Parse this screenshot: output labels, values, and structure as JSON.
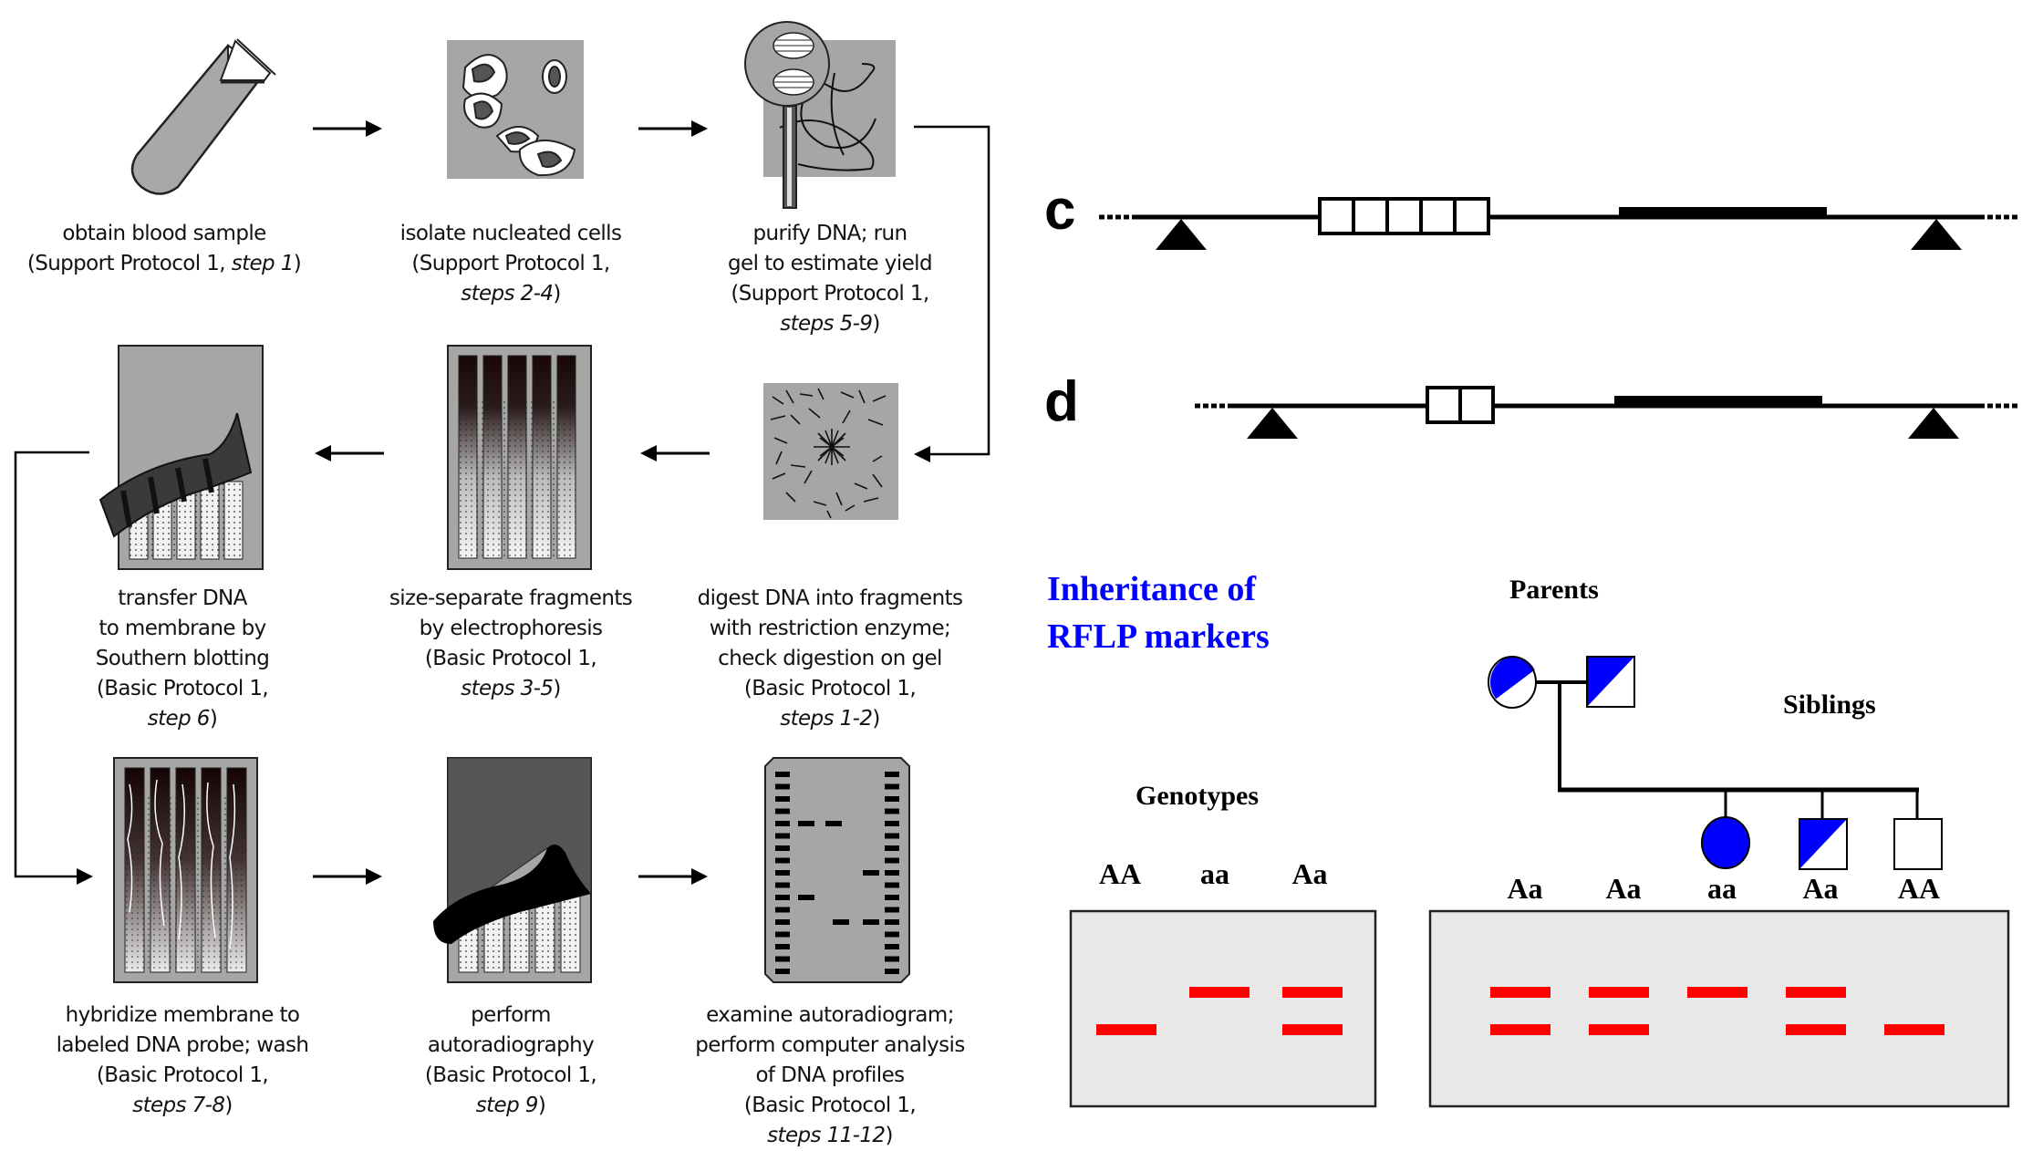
{
  "flowchart": {
    "steps": [
      {
        "id": "blood",
        "line1": "obtain blood sample",
        "line2": "(Support Protocol 1, ",
        "step": "step 1",
        "close": ")"
      },
      {
        "id": "cells",
        "line1": "isolate nucleated cells",
        "line2": "(Support Protocol 1,",
        "step": "steps 2-4",
        "close": ")"
      },
      {
        "id": "purify",
        "line1": "purify DNA; run",
        "line1b": "gel to estimate yield",
        "line2": "(Support Protocol 1,",
        "step": "steps 5-9",
        "close": ")"
      },
      {
        "id": "digest",
        "line1": "digest DNA into fragments",
        "line1b": "with restriction enzyme;",
        "line1c": "check digestion on gel",
        "line2": "(Basic Protocol 1,",
        "step": "steps 1-2",
        "close": ")"
      },
      {
        "id": "separate",
        "line1": "size-separate fragments",
        "line1b": "by electrophoresis",
        "line2": "(Basic Protocol 1,",
        "step": "steps 3-5",
        "close": ")"
      },
      {
        "id": "transfer",
        "line1": "transfer DNA",
        "line1b": "to membrane by",
        "line1c": "Southern blotting",
        "line2": "(Basic Protocol 1,",
        "step": "step 6",
        "close": ")"
      },
      {
        "id": "hybridize",
        "line1": "hybridize membrane to",
        "line1b": "labeled DNA probe; wash",
        "line2": "(Basic Protocol 1,",
        "step": "steps 7-8",
        "close": ")"
      },
      {
        "id": "autorad",
        "line1": "perform",
        "line1b": "autoradiography",
        "line2": "(Basic Protocol 1,",
        "step": "step 9",
        "close": ")"
      },
      {
        "id": "examine",
        "line1": "examine autoradiogram;",
        "line1b": "perform computer analysis",
        "line1c": "of DNA profiles",
        "line2": "(Basic Protocol 1,",
        "step": "steps 11-12",
        "close": ")"
      }
    ]
  },
  "loci": {
    "c": {
      "label": "c",
      "repeat_units": 5
    },
    "d": {
      "label": "d",
      "repeat_units": 2
    }
  },
  "inheritance": {
    "title_line1": "Inheritance of",
    "title_line2": "RFLP markers",
    "title_color": "#0000ff",
    "parents_label": "Parents",
    "siblings_label": "Siblings",
    "genotypes_label": "Genotypes",
    "fill_color": "#0000ff",
    "band_color": "#ff0000",
    "gel_bg": "#e8e8e8",
    "reference_lanes": [
      {
        "genotype": "AA",
        "bands": [
          "lower"
        ]
      },
      {
        "genotype": "aa",
        "bands": [
          "upper"
        ]
      },
      {
        "genotype": "Aa",
        "bands": [
          "upper",
          "lower"
        ]
      }
    ],
    "family_lanes": [
      {
        "genotype": "Aa",
        "member": "mother",
        "bands": [
          "upper",
          "lower"
        ]
      },
      {
        "genotype": "Aa",
        "member": "father",
        "bands": [
          "upper",
          "lower"
        ]
      },
      {
        "genotype": "aa",
        "member": "daughter",
        "bands": [
          "upper"
        ]
      },
      {
        "genotype": "Aa",
        "member": "son-1",
        "bands": [
          "upper",
          "lower"
        ]
      },
      {
        "genotype": "AA",
        "member": "son-2",
        "bands": [
          "lower"
        ]
      }
    ]
  }
}
